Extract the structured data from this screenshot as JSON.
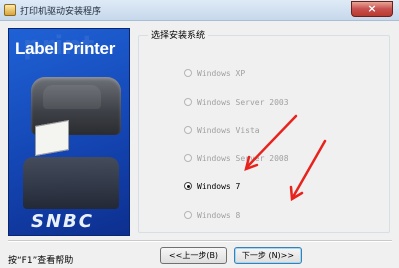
{
  "window": {
    "title": "打印机驱动安装程序",
    "close_glyph": "×"
  },
  "banner": {
    "title": "Label Printer",
    "watermark": "print",
    "logo": "SNBC"
  },
  "group": {
    "legend": "选择安装系统"
  },
  "options": [
    {
      "label": "Windows XP",
      "enabled": false,
      "selected": false
    },
    {
      "label": "Windows Server 2003",
      "enabled": false,
      "selected": false
    },
    {
      "label": "Windows Vista",
      "enabled": false,
      "selected": false
    },
    {
      "label": "Windows Server 2008",
      "enabled": false,
      "selected": false
    },
    {
      "label": "Windows 7",
      "enabled": true,
      "selected": true
    },
    {
      "label": "Windows 8",
      "enabled": false,
      "selected": false
    }
  ],
  "footer": {
    "help": "按“F1”查看帮助",
    "back_label": "<<上一步(B)",
    "next_label": "下一步 (N)>>"
  },
  "colors": {
    "annotation_arrow": "#e8231d",
    "banner_blue": "#1a4fc4"
  }
}
